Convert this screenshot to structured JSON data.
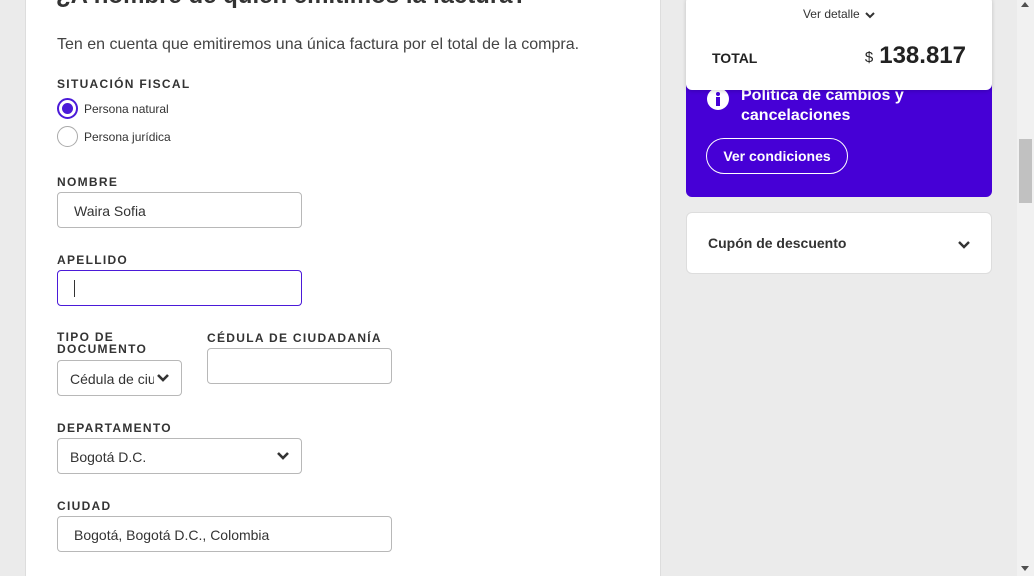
{
  "form": {
    "title": "¿A nombre de quién emitimos la factura?",
    "subtitle": "Ten en cuenta que emitiremos una única factura por el total de la compra.",
    "situacion_fiscal": {
      "label": "SITUACIÓN FISCAL",
      "options": [
        {
          "label": "Persona natural",
          "checked": true
        },
        {
          "label": "Persona jurídica",
          "checked": false
        }
      ]
    },
    "nombre": {
      "label": "NOMBRE",
      "value": "Waira Sofia"
    },
    "apellido": {
      "label": "APELLIDO",
      "value": ""
    },
    "tipo_documento": {
      "label_line1": "TIPO DE",
      "label_line2": "DOCUMENTO",
      "value": "Cédula de ciudadanía"
    },
    "cedula": {
      "label": "CÉDULA DE CIUDADANÍA",
      "value": ""
    },
    "departamento": {
      "label": "DEPARTAMENTO",
      "value": "Bogotá D.C."
    },
    "ciudad": {
      "label": "CIUDAD",
      "value": "Bogotá, Bogotá D.C., Colombia"
    }
  },
  "summary": {
    "ver_detalle": "Ver detalle",
    "total_label": "TOTAL",
    "currency": "$",
    "total_amount": "138.817"
  },
  "policy": {
    "title": "Política de cambios y cancelaciones",
    "button": "Ver condiciones",
    "color": "#4600d6"
  },
  "coupon": {
    "label": "Cupón de descuento"
  },
  "colors": {
    "accent": "#4b1ad8",
    "page_bg": "#ebebeb"
  }
}
